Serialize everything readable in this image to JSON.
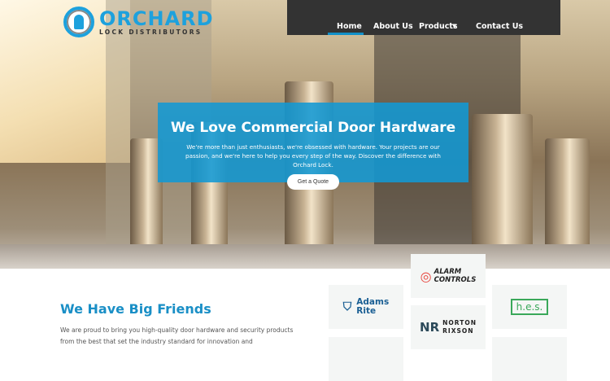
{
  "brand": {
    "name": "ORCHARD",
    "tagline": "LOCK DISTRIBUTORS"
  },
  "nav": {
    "items": [
      "Home",
      "About Us",
      "Products",
      "Contact Us"
    ],
    "active": "Home",
    "dropdown_icon": "caret-down-icon"
  },
  "hero": {
    "title": "We Love Commercial Door Hardware",
    "text": "We're more than just enthusiasts, we're obsessed with hardware. Your projects are our passion, and we're here to help you every step of the way. Discover the difference with Orchard Lock.",
    "cta": "Get a Quote"
  },
  "friends": {
    "title": "We Have Big Friends",
    "text": "We are proud to bring you high-quality door hardware and security products from the best that set the industry standard for innovation and",
    "brands": [
      {
        "line1": "Adams",
        "line2": "Rite"
      },
      {
        "line1": "ALARM",
        "line2": "CONTROLS"
      },
      {
        "line1": "h.e.s."
      },
      {
        "line1": "NORTON",
        "line2": "RIXSON"
      }
    ]
  },
  "colors": {
    "accent": "#1da1dd",
    "nav_bg": "#333333"
  }
}
